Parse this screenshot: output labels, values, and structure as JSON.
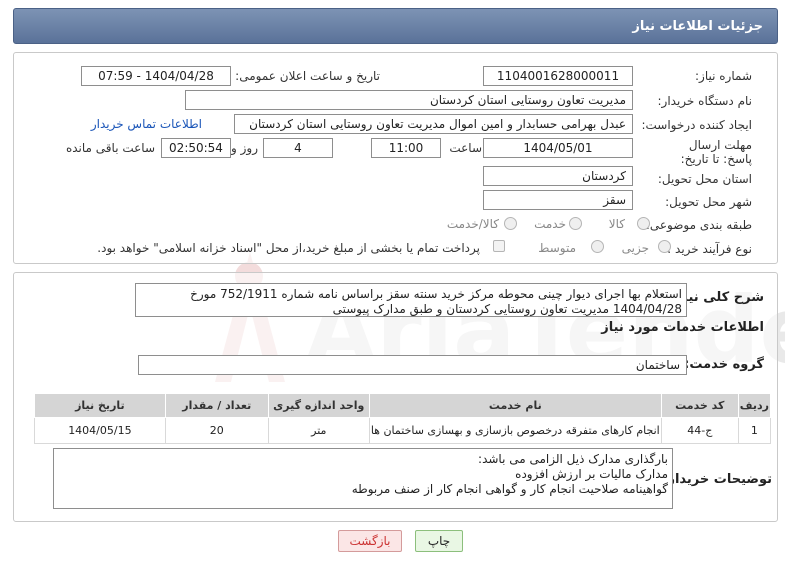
{
  "header": {
    "title": "جزئیات اطلاعات نیاز"
  },
  "form": {
    "need_number_label": "شماره نیاز:",
    "need_number": "1104001628000011",
    "announce_label": "تاریخ و ساعت اعلان عمومی:",
    "announce_value": "1404/04/28 - 07:59",
    "buyer_org_label": "نام دستگاه خریدار:",
    "buyer_org": "مدیریت تعاون روستایی استان کردستان",
    "creator_label": "ایجاد کننده درخواست:",
    "creator": "عبدل بهرامی حسابدار و امین اموال مدیریت تعاون روستایی استان کردستان",
    "contact_link": "اطلاعات تماس خریدار",
    "deadline_label": "مهلت ارسال پاسخ: تا تاریخ:",
    "deadline_date": "1404/05/01",
    "time_label": "ساعت",
    "deadline_time": "11:00",
    "days_value": "4",
    "days_label": "روز و",
    "remaining_time": "02:50:54",
    "remaining_label": "ساعت باقی مانده",
    "province_label": "استان محل تحویل:",
    "province": "کردستان",
    "city_label": "شهر محل تحویل:",
    "city": "سقز",
    "category_label": "طبقه بندی موضوعی:",
    "category_options": [
      "کالا",
      "خدمت",
      "کالا/خدمت"
    ],
    "process_label": "نوع فرآیند خرید :",
    "process_options": [
      "جزیی",
      "متوسط"
    ],
    "payment_note": "پرداخت تمام یا بخشی از مبلغ خرید،از محل \"اسناد خزانه اسلامی\" خواهد بود."
  },
  "summary": {
    "label": "شرح کلی نیاز:",
    "text": "استعلام بها اجرای دیوار چینی محوطه مرکز خرید سنته سقز براساس نامه شماره 752/1911 مورخ 1404/04/28 مدیریت تعاون روستایی کردستان و طبق مدارک پیوستی"
  },
  "services": {
    "section_title": "اطلاعات خدمات مورد نیاز",
    "group_label": "گروه خدمت:",
    "group_value": "ساختمان",
    "columns": [
      "ردیف",
      "کد خدمت",
      "نام خدمت",
      "واحد اندازه گیری",
      "تعداد / مقدار",
      "تاریخ نیاز"
    ],
    "rows": [
      [
        "1",
        "ج-44",
        "انجام کارهای متفرقه درخصوص بازسازی و بهسازی ساختمان ها",
        "متر",
        "20",
        "1404/05/15"
      ]
    ]
  },
  "buyer_notes": {
    "label": "توضیحات خریدار:",
    "lines": [
      "بارگذاری مدارک ذیل الزامی می باشد:",
      "مدارک مالیات بر ارزش افزوده",
      "گواهینامه صلاحیت انجام کار و گواهی انجام کار از صنف مربوطه"
    ]
  },
  "buttons": {
    "print": "چاپ",
    "back": "بازگشت"
  },
  "colors": {
    "header": "#6a81a6",
    "print_bg": "#e9f7e4",
    "back_bg": "#fbe6e6"
  }
}
